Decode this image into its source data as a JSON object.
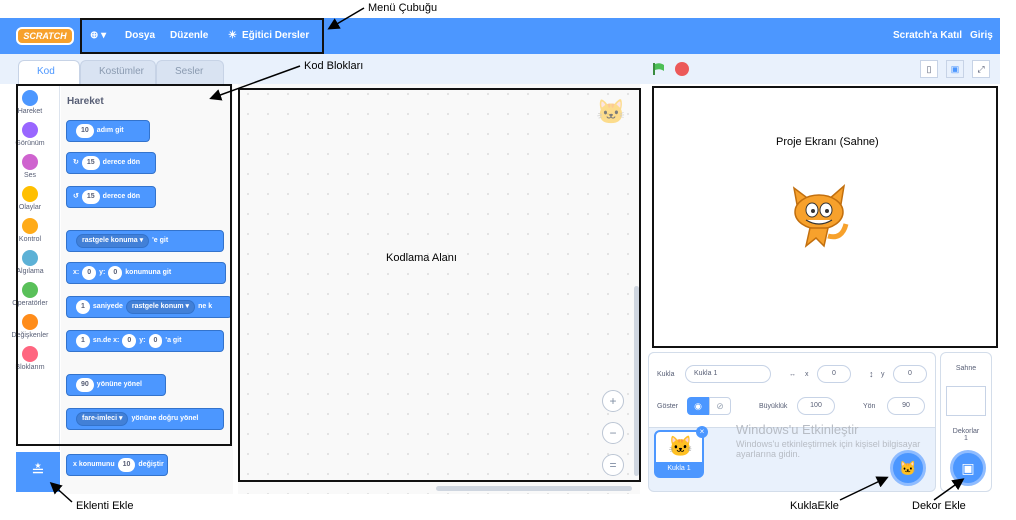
{
  "menu": {
    "logo": "SCRATCH",
    "globe": "⊕ ▾",
    "file": "Dosya",
    "edit": "Düzenle",
    "tutorials": "Eğitici Dersler",
    "join": "Scratch'a Katıl",
    "signin": "Giriş"
  },
  "tabs": {
    "code": "Kod",
    "costumes": "Kostümler",
    "sounds": "Sesler"
  },
  "categories": [
    {
      "label": "Hareket",
      "color": "#4c97ff"
    },
    {
      "label": "Görünüm",
      "color": "#9966ff"
    },
    {
      "label": "Ses",
      "color": "#cf63cf"
    },
    {
      "label": "Olaylar",
      "color": "#ffbf00"
    },
    {
      "label": "Kontrol",
      "color": "#ffab19"
    },
    {
      "label": "Algılama",
      "color": "#5cb1d6"
    },
    {
      "label": "Operatörler",
      "color": "#59c059"
    },
    {
      "label": "Değişkenler",
      "color": "#ff8c1a"
    },
    {
      "label": "Bloklarım",
      "color": "#ff6680"
    }
  ],
  "palette": {
    "title": "Hareket",
    "b1_val": "10",
    "b1_text": "adım git",
    "b2_val": "15",
    "b2_text": "derece dön",
    "b3_val": "15",
    "b3_text": "derece dön",
    "b4_dd": "rastgele konuma ▾",
    "b4_text": "'e git",
    "b5_x": "x:",
    "b5_xv": "0",
    "b5_y": "y:",
    "b5_yv": "0",
    "b5_text": "konumuna git",
    "b6_val": "1",
    "b6_mid": "saniyede",
    "b6_dd": "rastgele konum ▾",
    "b6_end": "ne k",
    "b7_val": "1",
    "b7_mid": "sn.de x:",
    "b7_xv": "0",
    "b7_y": "y:",
    "b7_yv": "0",
    "b7_end": "'a git",
    "b8_val": "90",
    "b8_text": "yönüne yönel",
    "b9_dd": "fare-imleci ▾",
    "b9_text": "yönüne doğru yönel",
    "b10_text": "x konumunu",
    "b10_val": "10",
    "b10_end": "değiştir"
  },
  "sprite_info": {
    "label": "Kukla",
    "name": "Kukla 1",
    "x_label": "x",
    "x_val": "0",
    "y_label": "y",
    "y_val": "0",
    "show_label": "Göster",
    "size_label": "Büyüklük",
    "size_val": "100",
    "dir_label": "Yön",
    "dir_val": "90",
    "thumb_label": "Kukla 1"
  },
  "stage_panel": {
    "title": "Sahne",
    "backdrops_label": "Dekorlar",
    "backdrops_count": "1"
  },
  "watermark": {
    "title": "Windows'u Etkinleştir",
    "line1": "Windows'u etkinleştirmek için kişisel bilgisayar",
    "line2": "ayarlarına gidin."
  },
  "annotations": {
    "menu": "Menü Çubuğu",
    "blocks": "Kod Blokları",
    "code_area": "Kodlama Alanı",
    "stage": "Proje Ekranı (Sahne)",
    "extension": "Eklenti Ekle",
    "add_sprite": "KuklaEkle",
    "add_backdrop": "Dekor Ekle"
  },
  "colors": {
    "accent": "#4c97ff",
    "motion": "#4c97ff",
    "flag": "#4cbf56",
    "stop": "#ec5959"
  }
}
